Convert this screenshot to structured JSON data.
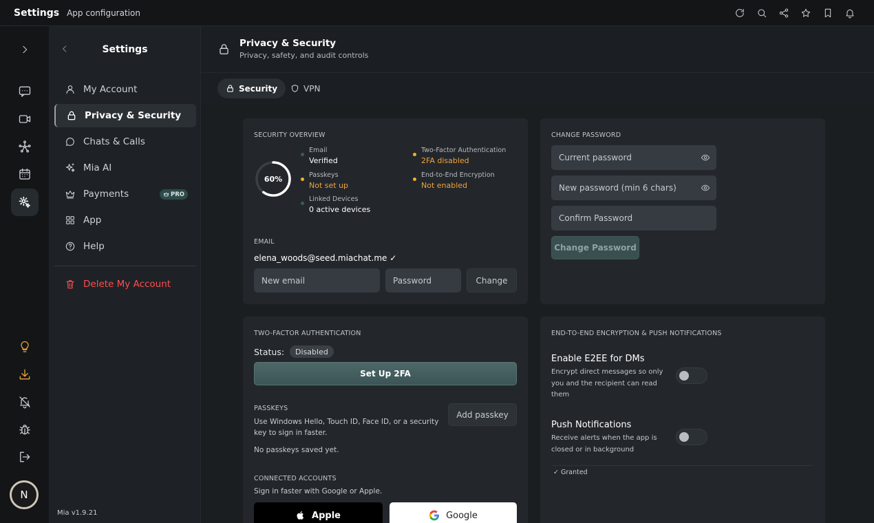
{
  "topbar": {
    "title": "Settings",
    "subtitle": "App configuration",
    "actions": [
      "refresh-icon",
      "search-icon",
      "share-icon",
      "star-icon",
      "bookmark-icon",
      "bell-icon"
    ]
  },
  "rail": {
    "items": [
      "expand-icon",
      "chat-icon",
      "video-icon",
      "network-icon",
      "calendar-icon",
      "gear-icon"
    ],
    "bottom_items": [
      "bulb-icon",
      "download-icon",
      "bell-off-icon",
      "bug-icon",
      "logout-icon"
    ],
    "avatar_initial": "N"
  },
  "nav": {
    "title": "Settings",
    "items": [
      {
        "label": "My Account",
        "icon": "user-icon"
      },
      {
        "label": "Privacy & Security",
        "icon": "lock-icon",
        "active": true
      },
      {
        "label": "Chats & Calls",
        "icon": "chat-bubble-icon"
      },
      {
        "label": "Mia AI",
        "icon": "sparkle-icon"
      },
      {
        "label": "Payments",
        "icon": "crown-icon",
        "badge": "PRO"
      },
      {
        "label": "App",
        "icon": "grid-icon"
      },
      {
        "label": "Help",
        "icon": "help-icon"
      }
    ],
    "delete_label": "Delete My Account",
    "version": "Mia v1.9.21"
  },
  "header": {
    "title": "Privacy & Security",
    "subtitle": "Privacy, safety, and audit controls"
  },
  "tabs": [
    {
      "label": "Security",
      "active": true
    },
    {
      "label": "VPN",
      "active": false
    }
  ],
  "overview": {
    "heading": "SECURITY OVERVIEW",
    "score": 60,
    "score_label": "60%",
    "stats": [
      {
        "label": "Email",
        "value": "Verified",
        "status": "ok"
      },
      {
        "label": "Passkeys",
        "value": "Not set up",
        "status": "warn"
      },
      {
        "label": "Linked Devices",
        "value": "0 active devices",
        "status": "ok"
      },
      {
        "label": "Two-Factor Authentication",
        "value": "2FA disabled",
        "status": "warn"
      },
      {
        "label": "End-to-End Encryption",
        "value": "Not enabled",
        "status": "warn"
      }
    ],
    "colors": {
      "ok": "#3d5a5a",
      "warn": "#f0b429",
      "ring": "#ffffff",
      "track": "#3a3f44"
    }
  },
  "email": {
    "heading": "EMAIL",
    "current": "elena_woods@seed.miachat.me ✓",
    "new_placeholder": "New email",
    "password_placeholder": "Password",
    "change_label": "Change"
  },
  "change_password": {
    "heading": "CHANGE PASSWORD",
    "current_placeholder": "Current password",
    "new_placeholder": "New password (min 6 chars)",
    "confirm_placeholder": "Confirm Password",
    "button_label": "Change Password"
  },
  "two_factor": {
    "heading": "TWO-FACTOR AUTHENTICATION",
    "status_label": "Status:",
    "status_value": "Disabled",
    "setup_label": "Set Up 2FA"
  },
  "passkeys": {
    "heading": "PASSKEYS",
    "description": "Use Windows Hello, Touch ID, Face ID, or a security key to sign in faster.",
    "empty": "No passkeys saved yet.",
    "add_label": "Add passkey"
  },
  "connected": {
    "heading": "CONNECTED ACCOUNTS",
    "description": "Sign in faster with Google or Apple.",
    "apple_label": "Apple",
    "google_label": "Google"
  },
  "e2ee": {
    "heading": "END-TO-END ENCRYPTION & PUSH NOTIFICATIONS",
    "e2ee_title": "Enable E2EE for DMs",
    "e2ee_desc": "Encrypt direct messages so only you and the recipient can read them",
    "e2ee_enabled": false,
    "push_title": "Push Notifications",
    "push_desc": "Receive alerts when the app is closed or in background",
    "push_enabled": false,
    "permission": "✓ Granted"
  }
}
